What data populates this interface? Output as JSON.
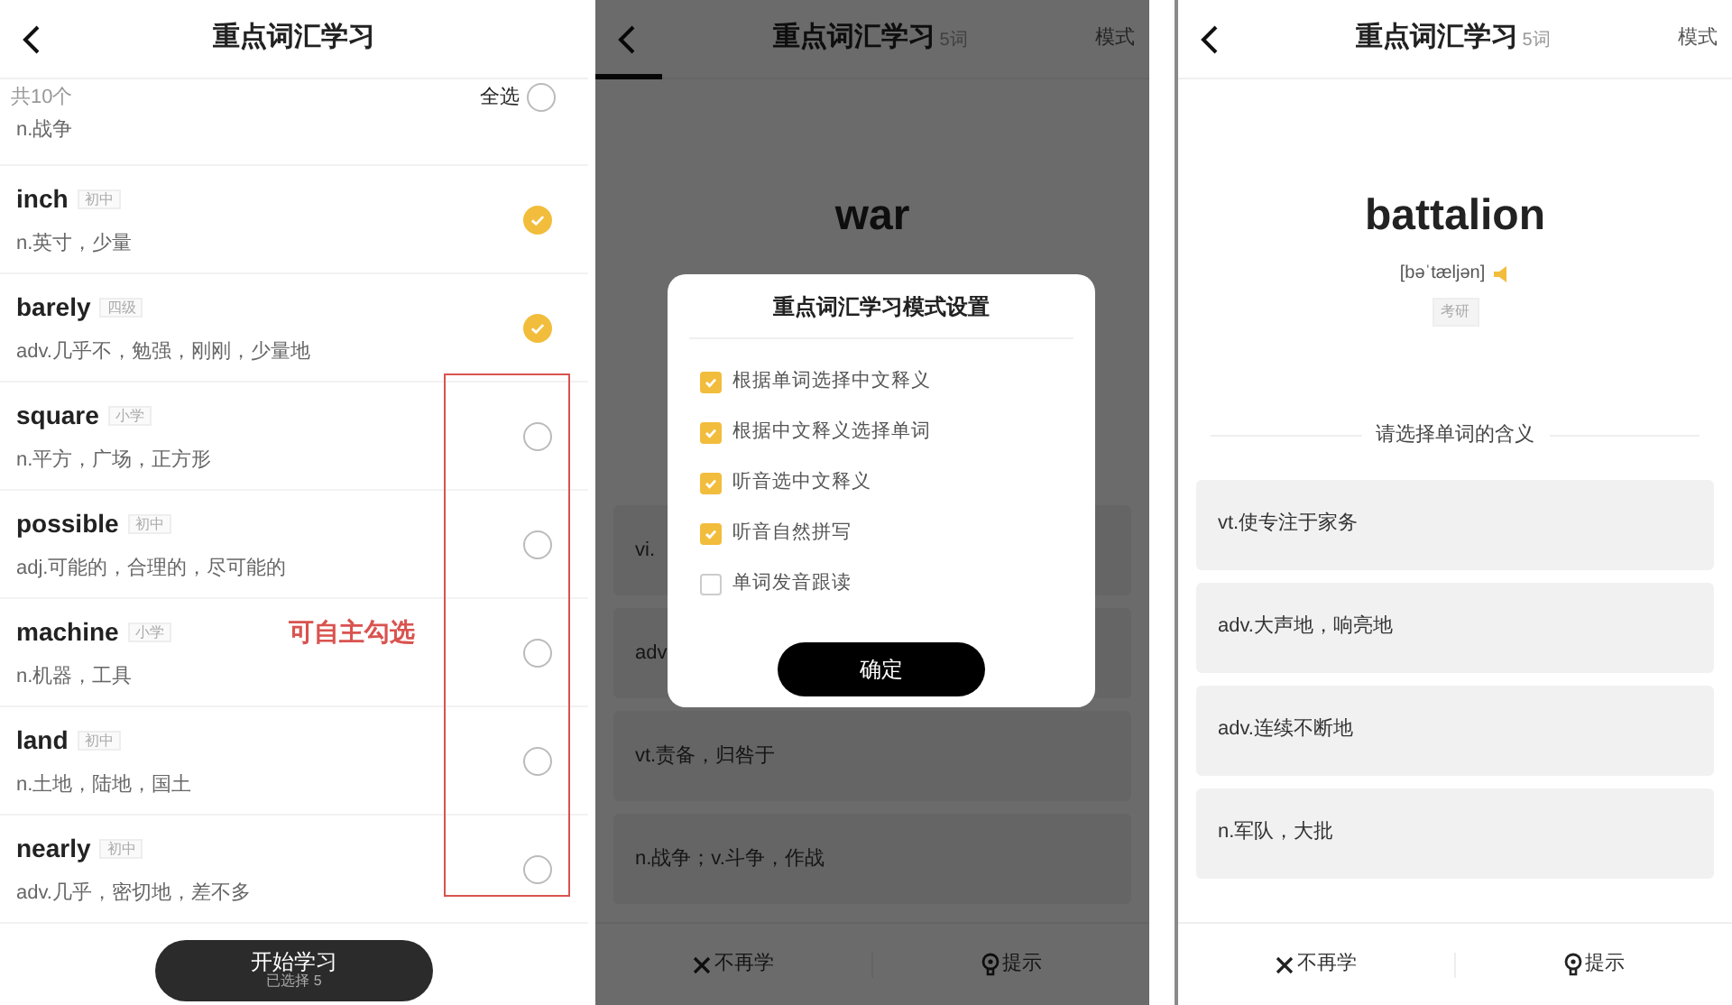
{
  "word_list_screen": {
    "title": "重点词汇学习",
    "count_label": "共10个",
    "select_all": {
      "label": "全选",
      "checked": false
    },
    "partial_row": {
      "meaning": "n.战争"
    },
    "words": [
      {
        "word": "inch",
        "tag": "初中",
        "meaning": "n.英寸，少量",
        "checked": true
      },
      {
        "word": "barely",
        "tag": "四级",
        "meaning": "adv.几乎不，勉强，刚刚，少量地",
        "checked": true
      },
      {
        "word": "square",
        "tag": "小学",
        "meaning": "n.平方，广场，正方形",
        "checked": false
      },
      {
        "word": "possible",
        "tag": "初中",
        "meaning": "adj.可能的，合理的，尽可能的",
        "checked": false
      },
      {
        "word": "machine",
        "tag": "小学",
        "meaning": "n.机器，工具",
        "checked": false
      },
      {
        "word": "land",
        "tag": "初中",
        "meaning": "n.土地，陆地，国土",
        "checked": false
      },
      {
        "word": "nearly",
        "tag": "初中",
        "meaning": "adv.几乎，密切地，差不多",
        "checked": false
      }
    ],
    "start_button": {
      "label": "开始学习",
      "sub_label": "已选择 5"
    },
    "annotation": {
      "text": "可自主勾选"
    }
  },
  "mode_dialog_screen": {
    "header": {
      "title": "重点词汇学习",
      "count": "5词",
      "mode": "模式"
    },
    "word": "war",
    "options": [
      "vi.",
      "adv",
      "vt.责备，归咎于",
      "n.战争；v.斗争，作战"
    ],
    "footer": {
      "skip": "不再学",
      "hint": "提示"
    },
    "dialog": {
      "title": "重点词汇学习模式设置",
      "modes": [
        {
          "label": "根据单词选择中文释义",
          "checked": true
        },
        {
          "label": "根据中文释义选择单词",
          "checked": true
        },
        {
          "label": "听音选中文释义",
          "checked": true
        },
        {
          "label": "听音自然拼写",
          "checked": true
        },
        {
          "label": "单词发音跟读",
          "checked": false
        }
      ],
      "confirm": "确定"
    }
  },
  "quiz_screen": {
    "header": {
      "title": "重点词汇学习",
      "count": "5词",
      "mode": "模式"
    },
    "word": "battalion",
    "phonetic": "[bəˈtæljən]",
    "tag": "考研",
    "prompt": "请选择单词的含义",
    "options": [
      "vt.使专注于家务",
      "adv.大声地，响亮地",
      "adv.连续不断地",
      "n.军队，大批"
    ],
    "footer": {
      "skip": "不再学",
      "hint": "提示"
    }
  }
}
